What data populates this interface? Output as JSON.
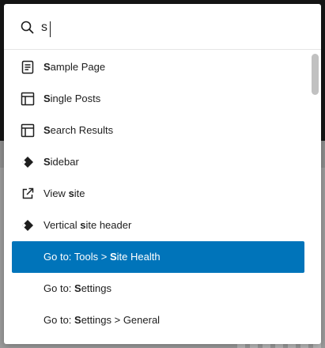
{
  "search": {
    "value": "s",
    "placeholder": ""
  },
  "results": [
    {
      "icon": "page-icon",
      "prefix": "",
      "match": "S",
      "rest": "ample Page"
    },
    {
      "icon": "layout-icon",
      "prefix": "",
      "match": "S",
      "rest": "ingle Posts"
    },
    {
      "icon": "layout-icon",
      "prefix": "",
      "match": "S",
      "rest": "earch Results"
    },
    {
      "icon": "diamond-icon",
      "prefix": "",
      "match": "S",
      "rest": "idebar"
    },
    {
      "icon": "external-link-icon",
      "prefix": "View ",
      "match": "s",
      "rest": "ite"
    },
    {
      "icon": "diamond-icon",
      "prefix": "Vertical ",
      "match": "s",
      "rest": "ite header"
    },
    {
      "icon": "",
      "prefix": "Go to: Tools > ",
      "match": "S",
      "rest": "ite Health"
    },
    {
      "icon": "",
      "prefix": "Go to: ",
      "match": "S",
      "rest": "ettings"
    },
    {
      "icon": "",
      "prefix": "Go to: ",
      "match": "S",
      "rest": "ettings > General"
    }
  ],
  "selected_index": 6,
  "colors": {
    "selected_bg": "#0074ba",
    "text": "#1e1e1e"
  }
}
